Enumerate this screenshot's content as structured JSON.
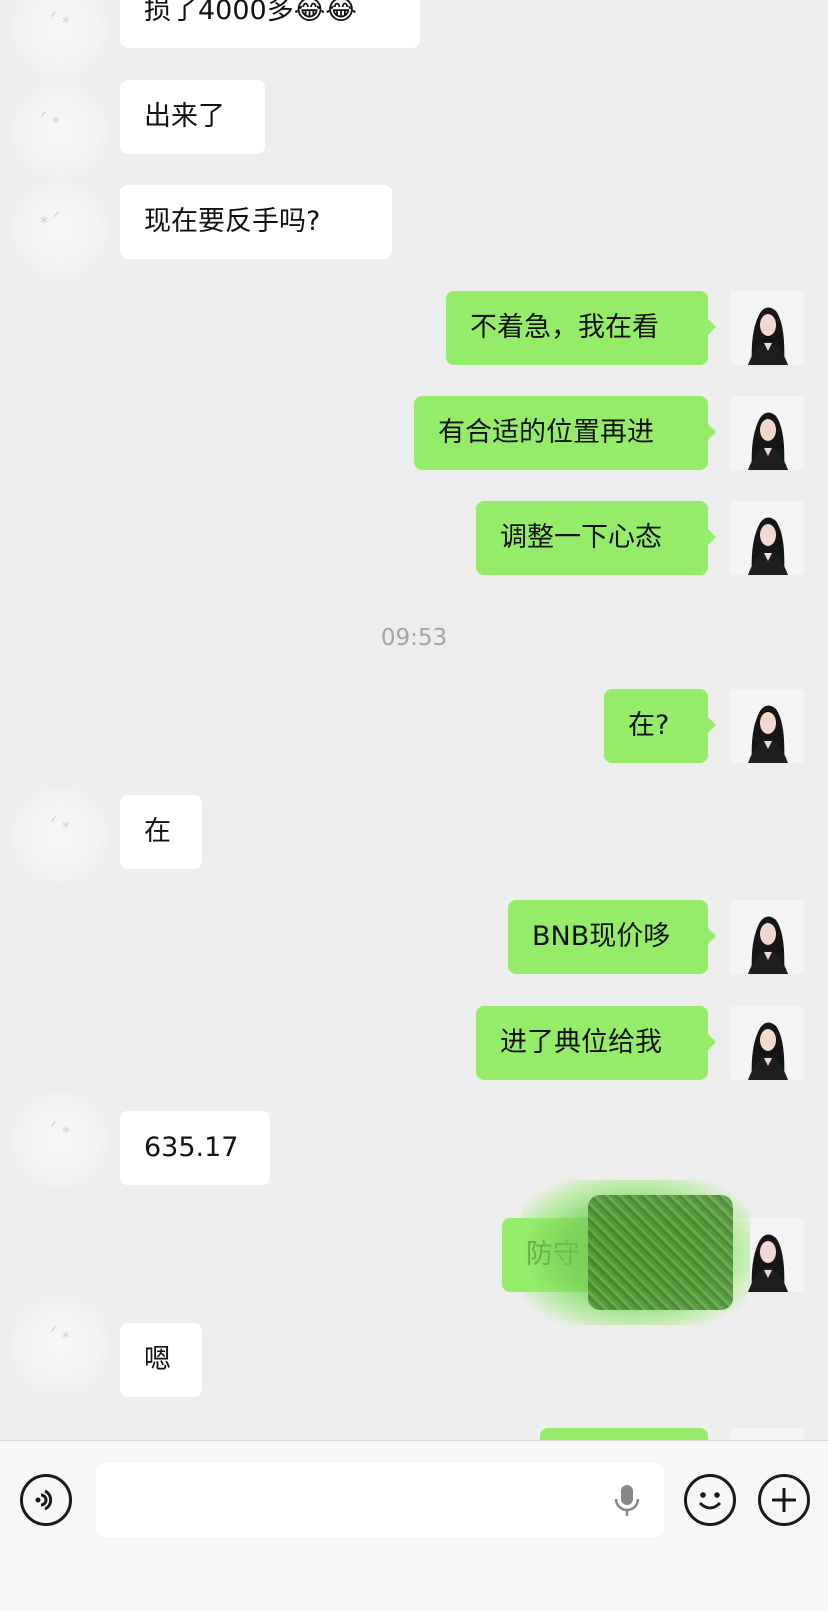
{
  "messages": [
    {
      "side": "in",
      "text": "损了4000多😂😂"
    },
    {
      "side": "in",
      "text": "出来了"
    },
    {
      "side": "in",
      "text": "现在要反手吗?"
    },
    {
      "side": "out",
      "text": "不着急，我在看"
    },
    {
      "side": "out",
      "text": "有合适的位置再进"
    },
    {
      "side": "out",
      "text": "调整一下心态"
    },
    {
      "type": "time",
      "text": "09:53"
    },
    {
      "side": "out",
      "text": "在?"
    },
    {
      "side": "in",
      "text": "在"
    },
    {
      "side": "out",
      "text": "BNB现价哆"
    },
    {
      "side": "out",
      "text": "进了典位给我"
    },
    {
      "side": "in",
      "text": "635.17"
    },
    {
      "side": "out",
      "text": "防守",
      "obscured": true
    },
    {
      "side": "in",
      "text": "嗯"
    }
  ],
  "input_bar": {
    "voice_button_icon": "voice-icon",
    "input_value": "",
    "mic_icon": "microphone-icon",
    "emoji_button_icon": "emoji-icon",
    "plus_button_icon": "plus-icon"
  },
  "colors": {
    "background": "#ededed",
    "outgoing_bubble": "#95ec69",
    "incoming_bubble": "#ffffff",
    "timestamp": "#a5a5a5"
  }
}
